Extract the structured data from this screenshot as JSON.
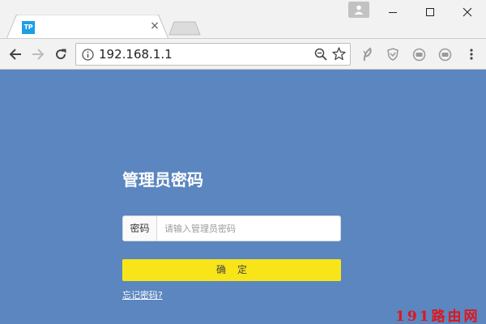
{
  "browser": {
    "tab": {
      "favicon_text": "TP",
      "title": "",
      "close_glyph": "×"
    },
    "address_bar": {
      "url": "192.168.1.1"
    },
    "icons": {
      "info": "info-icon",
      "zoom": "zoom-icon",
      "star": "star-icon",
      "profile": "profile-icon"
    },
    "colors": {
      "favicon_bg": "#1d9fe3",
      "chrome_bg": "#f2f2f2"
    }
  },
  "page": {
    "background": "#5b86bf",
    "title": "管理员密码",
    "password": {
      "label": "密码",
      "value": "",
      "placeholder": "请输入管理员密码"
    },
    "confirm_label": "确定",
    "forgot_link": "忘记密码?",
    "accent": "#f7e51a"
  },
  "watermark": {
    "text": "191路由网",
    "color": "#e0161c"
  }
}
